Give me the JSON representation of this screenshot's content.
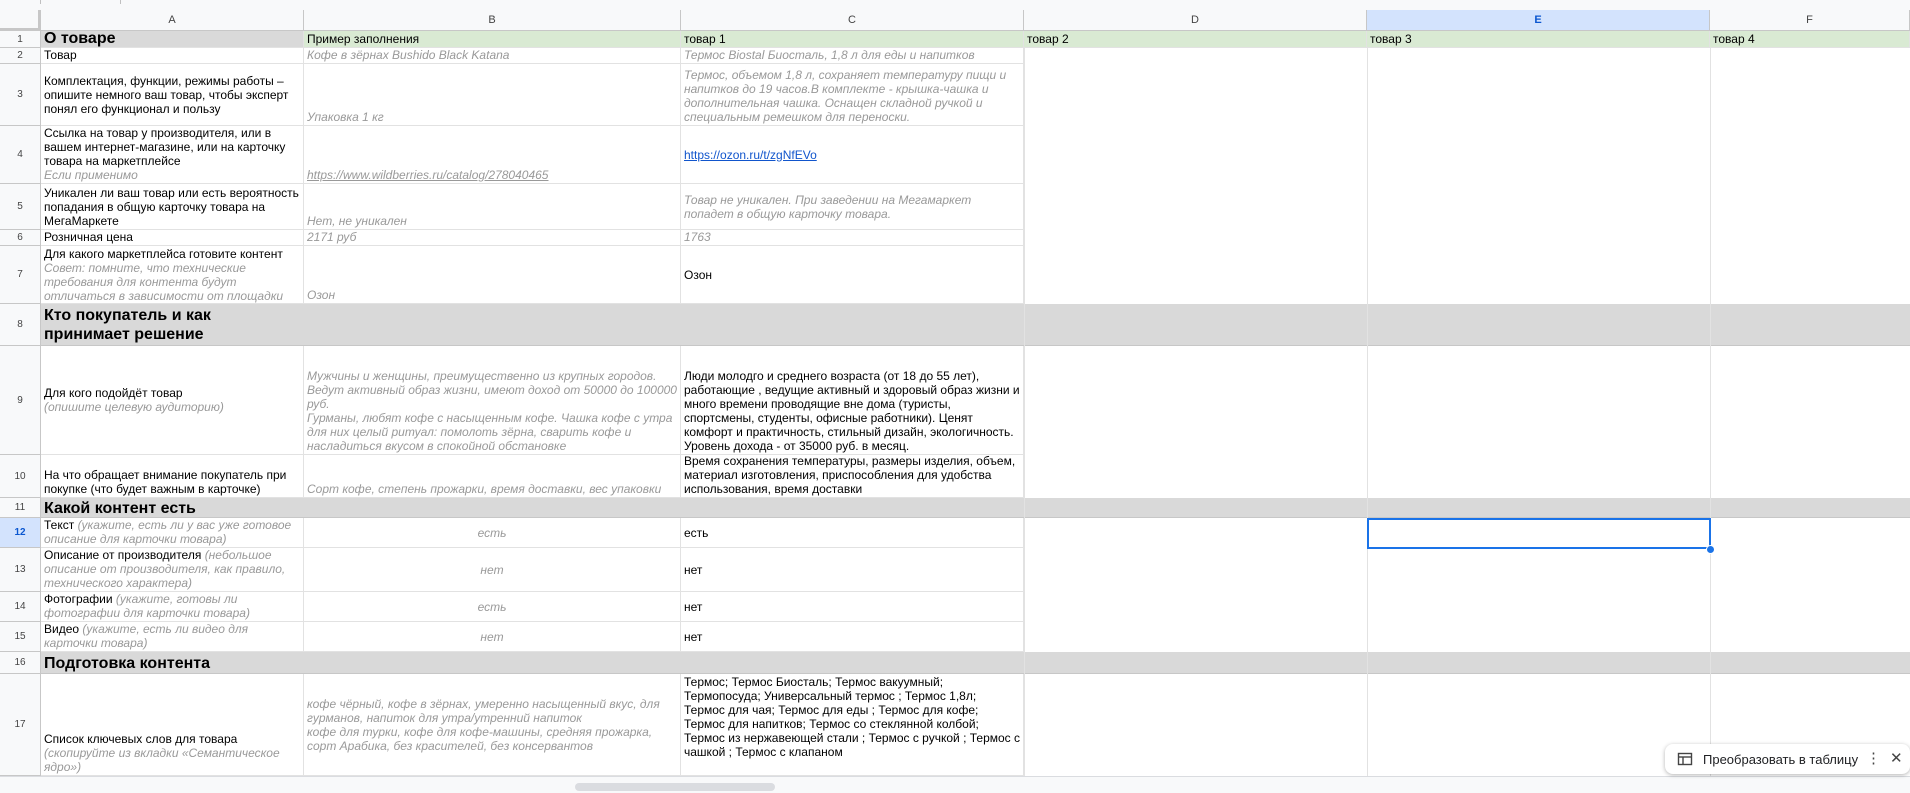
{
  "columns": [
    "A",
    "B",
    "C",
    "D",
    "E",
    "F"
  ],
  "selected_column": "E",
  "selected_row": "12",
  "rows": [
    "1",
    "2",
    "3",
    "4",
    "5",
    "6",
    "7",
    "8",
    "9",
    "10",
    "11",
    "12",
    "13",
    "14",
    "15",
    "16",
    "17"
  ],
  "header_row": {
    "a": "О товаре",
    "b": "Пример заполнения",
    "c": "товар 1",
    "d": "товар 2",
    "e": "товар 3",
    "f": "товар 4"
  },
  "r2": {
    "a": "Товар",
    "b": "Кофе в зёрнах Bushido Black Katana",
    "c": "Термос Biostal Биосталь, 1,8 л для еды и напитков"
  },
  "r3": {
    "a": "Комплектация, функции, режимы работы – опишите немного ваш товар, чтобы эксперт понял его функционал и пользу",
    "b": "Упаковка 1 кг",
    "c": "Термос, объемом 1,8 л, сохраняет температуру пищи и напитков до 19 часов.В комплекте - крышка-чашка и дополнительная чашка. Оснащен складной ручкой и специальным ремешком для переноски."
  },
  "r4": {
    "a": "Ссылка на товар у производителя, или в вашем интернет-магазине, или на карточку товара на маркетплейсе",
    "a_hint": "Если применимо",
    "b": "https://www.wildberries.ru/catalog/278040465",
    "c": "https://ozon.ru/t/zgNfEVo"
  },
  "r5": {
    "a": "Уникален ли ваш товар или есть вероятность попадания в общую карточку товара на МегаМаркете",
    "b": "Нет, не уникален",
    "c": "Товар не уникален. При заведении на Мегамаркет попадет в общую карточку товара."
  },
  "r6": {
    "a": "Розничная цена",
    "b": "2171 руб",
    "c": "1763"
  },
  "r7": {
    "a": "Для какого маркетплейса готовите контент",
    "a_hint": "Совет: помните, что технические требования для контента будут отличаться в зависимости от площадки",
    "b": "Озон",
    "c": "Озон"
  },
  "section_buyer": "Кто покупатель и как принимает решение",
  "r9": {
    "a": "Для кого подойдёт товар",
    "a_hint": "(опишите целевую аудиторию)",
    "b": "Мужчины и женщины, преимущественно из крупных городов. Ведут активный образ жизни, имеют доход от 50000 до 100000 руб.\nГурманы, любят кофе с насыщенным кофе. Чашка кофе с утра для них целый ритуал: помолоть зёрна, сварить кофе и насладиться вкусом в спокойной обстановке",
    "c": "Люди молодго и среднего возраста (от 18 до 55 лет), работающие , ведущие активный и здоровый образ жизни и много времени проводящие вне дома (туристы, спортсмены, студенты, офисные работники). Ценят комфорт и практичность, стильный дизайн, экологичность. Уровень дохода - от 35000 руб. в месяц."
  },
  "r10": {
    "a": "На что обращает внимание покупатель при покупке (что будет важным в карточке)",
    "b": "Сорт кофе, степень прожарки, время доставки, вес упаковки",
    "c": "Время сохранения температуры, размеры изделия, объем, материал изготовления, приспособления для удобства использования, время доставки"
  },
  "section_content": "Какой контент есть",
  "r12": {
    "a": "Текст",
    "a_hint": "(укажите, есть ли у вас уже готовое описание для карточки товара)",
    "b": "есть",
    "c": "есть"
  },
  "r13": {
    "a": "Описание от производителя",
    "a_hint": "(небольшое описание от производителя, как правило, технического характера)",
    "b": "нет",
    "c": "нет"
  },
  "r14": {
    "a": "Фотографии",
    "a_hint": "(укажите, готовы ли фотографии для карточки товара)",
    "b": "есть",
    "c": "нет"
  },
  "r15": {
    "a": "Видео",
    "a_hint": "(укажите, есть ли видео для карточки товара)",
    "b": "нет",
    "c": "нет"
  },
  "section_prep": "Подготовка контента",
  "r17": {
    "a": "Список ключевых слов для товара",
    "a_hint": "(скопируйте из вкладки «Семантическое ядро»)",
    "b": "кофе чёрный, кофе в зёрнах, умеренно насыщенный вкус, для гурманов, напиток для утра/утренний напиток\nкофе для турки, кофе для кофе-машины, средняя прожарка, сорт Арабика, без красителей, без консервантов",
    "c": "Термос; Термос Биосталь; Термос вакуумный; Термопосуда; Универсальный термос ; Термос 1,8л; Термос для чая; Термос для еды ; Термос для кофе; Термос для напитков; Термос со стеклянной колбой; Термос из нержавеющей стали ; Термос с ручкой ; Термос с чашкой ; Термос с клапаном"
  },
  "convert_button": "Преобразовать в таблицу",
  "more_icon_glyph": "⋮",
  "close_icon_glyph": "✕"
}
